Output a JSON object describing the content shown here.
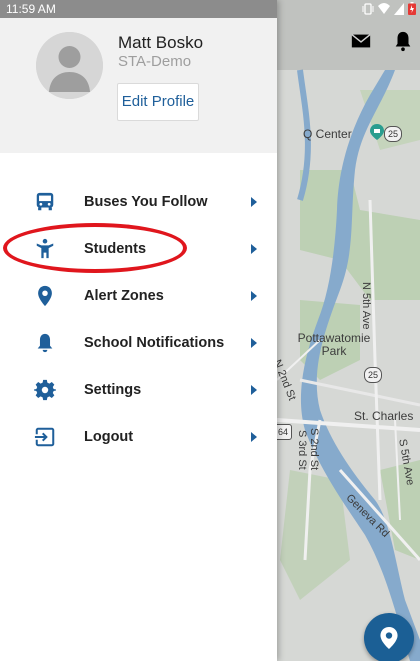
{
  "status_bar": {
    "time": "11:59 AM"
  },
  "profile": {
    "name": "Matt Bosko",
    "organization": "STA-Demo",
    "edit_button_label": "Edit Profile"
  },
  "menu": {
    "items": [
      {
        "label": "Buses You Follow",
        "icon": "bus-icon"
      },
      {
        "label": "Students",
        "icon": "student-icon"
      },
      {
        "label": "Alert Zones",
        "icon": "map-pin-icon"
      },
      {
        "label": "School Notifications",
        "icon": "bell-icon"
      },
      {
        "label": "Settings",
        "icon": "gear-icon"
      },
      {
        "label": "Logout",
        "icon": "logout-icon"
      }
    ]
  },
  "map": {
    "labels": {
      "q_center": "Q Center",
      "route_25_a": "25",
      "n_5th_ave": "N 5th Ave",
      "pottawatomie_park": "Pottawatomie Park",
      "n_2nd_st": "N 2nd St",
      "route_25_b": "25",
      "st_charles": "St. Charles",
      "route_64": "64",
      "s_2nd_st": "S 2nd St",
      "s_3rd_st": "S 3rd St",
      "s_5th_ave": "S 5th Ave",
      "geneva_rd": "Geneva Rd"
    }
  },
  "colors": {
    "accent": "#1f5f9a",
    "fab": "#1b5f95",
    "highlight": "#e0161d",
    "water": "#8fb5d9",
    "park": "#c9ddc0"
  }
}
